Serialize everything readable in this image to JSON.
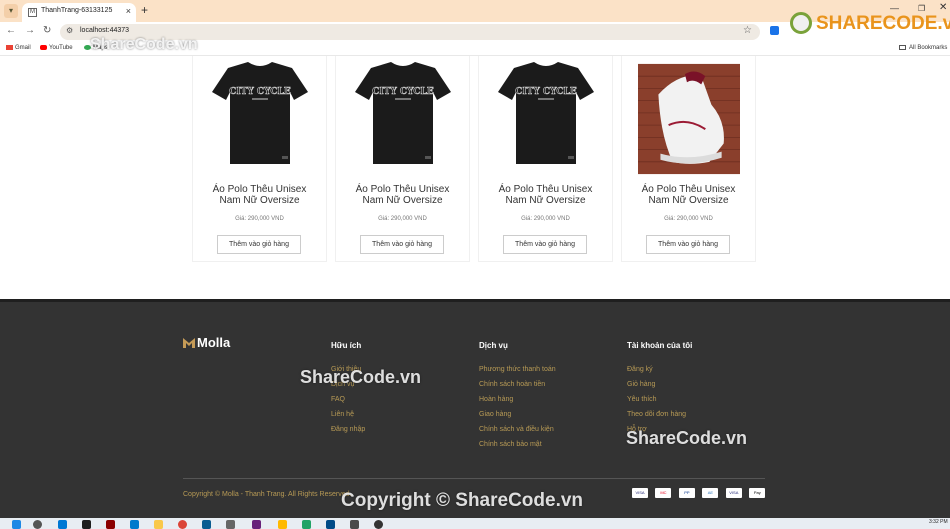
{
  "browser": {
    "tab_title": "ThanhTrang-63133125",
    "new_tab": "+",
    "url": "localhost:44373",
    "bookmarks": [
      "Gmail",
      "YouTube",
      "Maps"
    ],
    "all_bookmarks": "All Bookmarks"
  },
  "products": [
    {
      "name": "Áo Polo Thêu Unisex Nam Nữ Oversize",
      "price": "Giá: 290,000 VND",
      "button": "Thêm vào giỏ hàng",
      "image": "black-tshirt"
    },
    {
      "name": "Áo Polo Thêu Unisex Nam Nữ Oversize",
      "price": "Giá: 290,000 VND",
      "button": "Thêm vào giỏ hàng",
      "image": "black-tshirt"
    },
    {
      "name": "Áo Polo Thêu Unisex Nam Nữ Oversize",
      "price": "Giá: 290,000 VND",
      "button": "Thêm vào giỏ hàng",
      "image": "black-tshirt"
    },
    {
      "name": "Áo Polo Thêu Unisex Nam Nữ Oversize",
      "price": "Giá: 290,000 VND",
      "button": "Thêm vào giỏ hàng",
      "image": "white-sneaker"
    }
  ],
  "footer": {
    "logo": "Molla",
    "columns": [
      {
        "title": "Hữu ích",
        "links": [
          "Giới thiệu",
          "Dịch vụ",
          "FAQ",
          "Liên hệ",
          "Đăng nhập"
        ]
      },
      {
        "title": "Dịch vụ",
        "links": [
          "Phương thức thanh toán",
          "Chính sách hoàn tiền",
          "Hoàn hàng",
          "Giao hàng",
          "Chính sách và điều kiện",
          "Chính sách bảo mật"
        ]
      },
      {
        "title": "Tài khoản của tôi",
        "links": [
          "Đăng ký",
          "Giỏ hàng",
          "Yêu thích",
          "Theo dõi đơn hàng",
          "Hỗ trợ"
        ]
      }
    ],
    "copyright": "Copyright © Molla - Thanh Trang. All Rights Reserved.",
    "payments": [
      "VISA",
      "MC",
      "PP",
      "AE",
      "VISA",
      "Pay"
    ]
  },
  "taskbar": {
    "time": "3:32 PM"
  },
  "watermarks": {
    "logo": "SHARECODE.vn",
    "marks": [
      "ShareCode.vn",
      "ShareCode.vn",
      "ShareCode.vn"
    ],
    "copyright": "Copyright © ShareCode.vn"
  },
  "colors": {
    "footer_bg": "#333333",
    "footer_link": "#b79a55",
    "tabbar": "#fbe2c7"
  }
}
